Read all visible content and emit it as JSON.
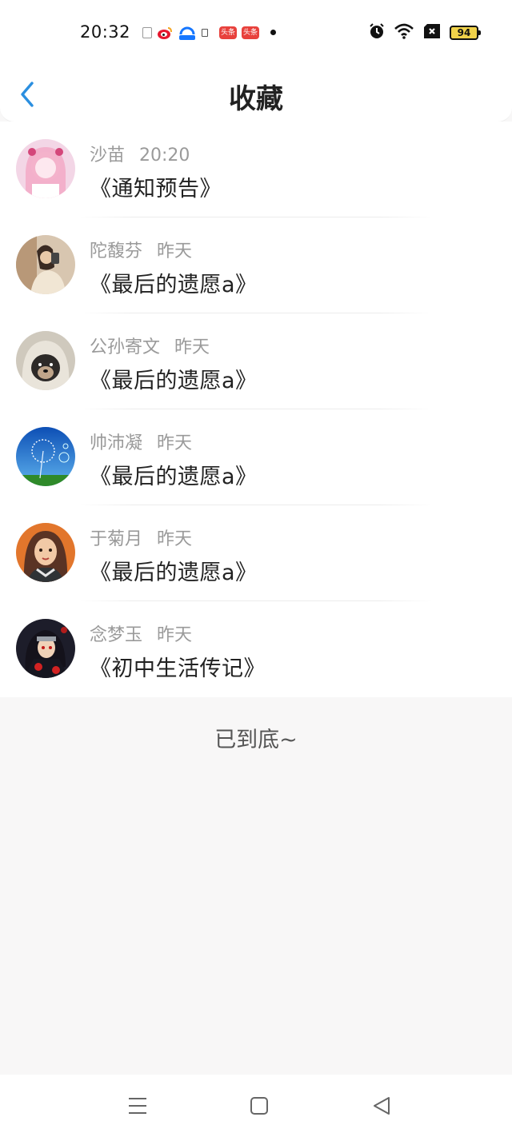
{
  "status_bar": {
    "time": "20:32",
    "battery": "94",
    "icons": [
      "notification-icon",
      "weibo-icon",
      "alipay-icon",
      "toutiao-icon",
      "toutiao-icon",
      "alarm-icon",
      "wifi-icon",
      "sim-off-icon",
      "battery-icon"
    ],
    "app_badge_1": "头条",
    "app_badge_2": "头条"
  },
  "header": {
    "title": "收藏",
    "back_icon": "chevron-left-icon"
  },
  "items": [
    {
      "name": "沙苗",
      "time": "20:20",
      "title": "《通知预告》"
    },
    {
      "name": "陀馥芬",
      "time": "昨天",
      "title": "《最后的遗愿a》"
    },
    {
      "name": "公孙寄文",
      "time": "昨天",
      "title": "《最后的遗愿a》"
    },
    {
      "name": "帅沛凝",
      "time": "昨天",
      "title": "《最后的遗愿a》"
    },
    {
      "name": "于菊月",
      "time": "昨天",
      "title": "《最后的遗愿a》"
    },
    {
      "name": "念梦玉",
      "time": "昨天",
      "title": "《初中生活传记》"
    }
  ],
  "footer": {
    "end_text": "已到底~"
  },
  "nav": {
    "icons": [
      "menu-icon",
      "home-square-icon",
      "back-triangle-icon"
    ]
  },
  "colors": {
    "accent": "#2b8fe0",
    "background": "#f8f7f7",
    "meta_text": "#9a9a9a"
  }
}
